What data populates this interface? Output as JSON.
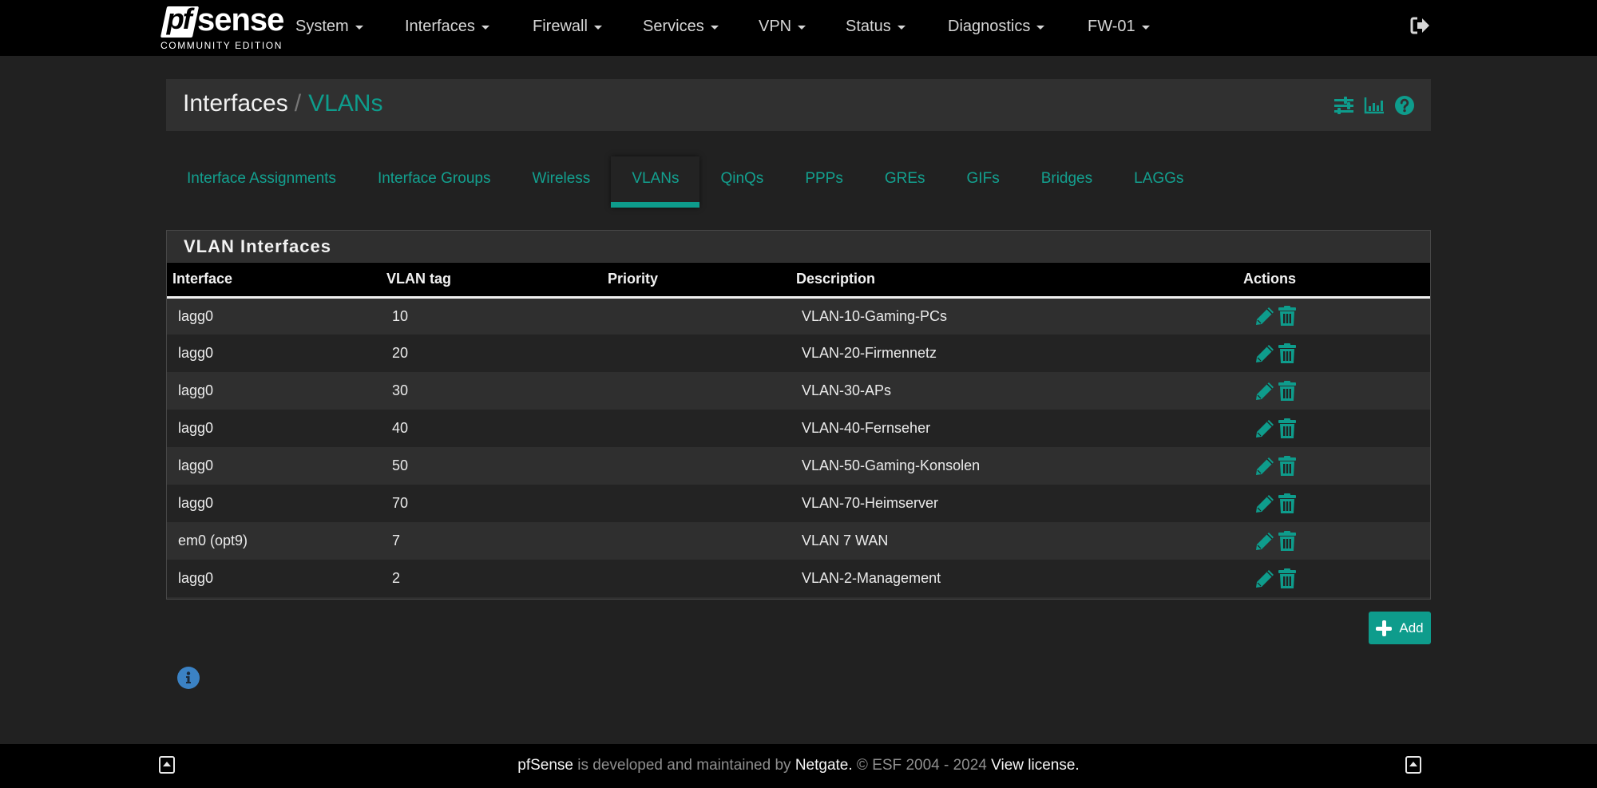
{
  "brand": {
    "logo_pf": "pf",
    "logo_sense": "sense",
    "edition": "COMMUNITY EDITION"
  },
  "nav": {
    "items": [
      {
        "label": "System"
      },
      {
        "label": "Interfaces"
      },
      {
        "label": "Firewall"
      },
      {
        "label": "Services"
      },
      {
        "label": "VPN"
      },
      {
        "label": "Status"
      },
      {
        "label": "Diagnostics"
      },
      {
        "label": "FW-01"
      }
    ],
    "logout_icon": "sign-out-icon"
  },
  "header": {
    "breadcrumb": [
      "Interfaces",
      "VLANs"
    ],
    "separator": "/",
    "icons": [
      "sliders-icon",
      "bar-chart-icon",
      "help-icon"
    ]
  },
  "tabs": [
    {
      "label": "Interface Assignments",
      "active": false
    },
    {
      "label": "Interface Groups",
      "active": false
    },
    {
      "label": "Wireless",
      "active": false
    },
    {
      "label": "VLANs",
      "active": true
    },
    {
      "label": "QinQs",
      "active": false
    },
    {
      "label": "PPPs",
      "active": false
    },
    {
      "label": "GREs",
      "active": false
    },
    {
      "label": "GIFs",
      "active": false
    },
    {
      "label": "Bridges",
      "active": false
    },
    {
      "label": "LAGGs",
      "active": false
    }
  ],
  "panel": {
    "title": "VLAN Interfaces",
    "columns": [
      "Interface",
      "VLAN tag",
      "Priority",
      "Description",
      "Actions"
    ],
    "rows": [
      {
        "interface": "lagg0",
        "tag": "10",
        "priority": "",
        "description": "VLAN-10-Gaming-PCs"
      },
      {
        "interface": "lagg0",
        "tag": "20",
        "priority": "",
        "description": "VLAN-20-Firmennetz"
      },
      {
        "interface": "lagg0",
        "tag": "30",
        "priority": "",
        "description": "VLAN-30-APs"
      },
      {
        "interface": "lagg0",
        "tag": "40",
        "priority": "",
        "description": "VLAN-40-Fernseher"
      },
      {
        "interface": "lagg0",
        "tag": "50",
        "priority": "",
        "description": "VLAN-50-Gaming-Konsolen"
      },
      {
        "interface": "lagg0",
        "tag": "70",
        "priority": "",
        "description": "VLAN-70-Heimserver"
      },
      {
        "interface": "em0 (opt9)",
        "tag": "7",
        "priority": "",
        "description": "VLAN 7 WAN"
      },
      {
        "interface": "lagg0",
        "tag": "2",
        "priority": "",
        "description": "VLAN-2-Management"
      }
    ],
    "row_actions": [
      "pencil-icon",
      "trash-icon"
    ]
  },
  "add_button": {
    "label": "Add",
    "icon": "plus-icon"
  },
  "info_icon": "info-circle-icon",
  "footer": {
    "brand": "pfSense",
    "text1": " is developed and maintained by ",
    "company": "Netgate.",
    "text2": " © ESF 2004 - 2024 ",
    "license": "View license."
  },
  "colors": {
    "accent": "#0e9c8c",
    "info": "#3b82c4",
    "navbar": "#000000",
    "background": "#212121"
  }
}
